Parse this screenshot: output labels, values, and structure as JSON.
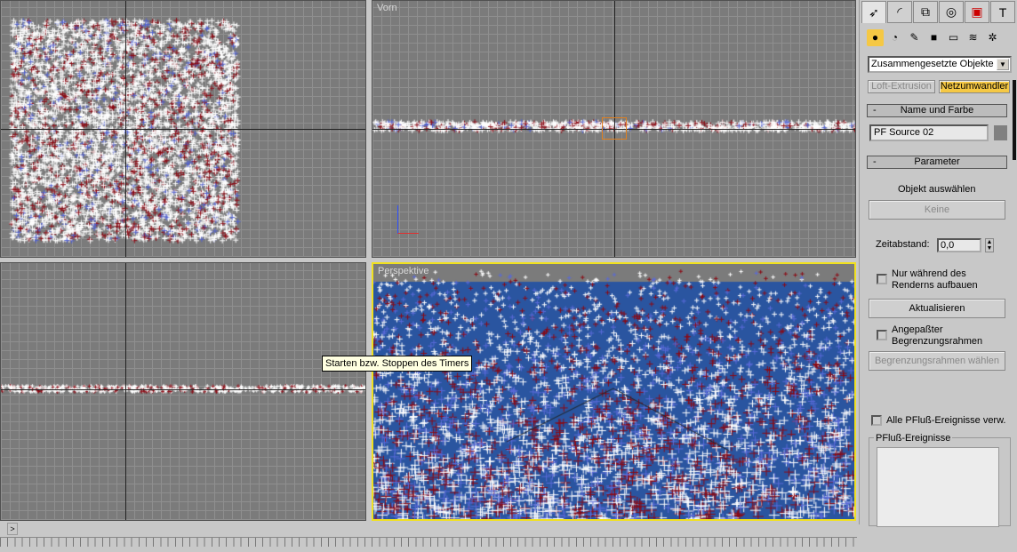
{
  "viewports": {
    "top_left": {
      "label": ""
    },
    "top_right": {
      "label": "Vorn"
    },
    "bottom_left": {
      "label": ""
    },
    "perspective": {
      "label": "Perspektive",
      "active": true
    }
  },
  "tooltip": "Starten bzw. Stoppen des Timers",
  "colors": {
    "viewport_bg": "#7b7b7b",
    "active_border": "#f0e020",
    "particles_white": "#ffffff",
    "particles_red": "#8b0a14",
    "perspective_ground": "#2a55a0",
    "highlight": "#f5c844"
  },
  "command_panel": {
    "tabs": [
      "create-icon",
      "modify-icon",
      "hierarchy-icon",
      "motion-icon",
      "display-icon",
      "utilities-icon"
    ],
    "category_icons": [
      "geometry-icon",
      "shapes-icon",
      "lights-icon",
      "cameras-icon",
      "helpers-icon",
      "spacewarps-icon",
      "systems-icon"
    ],
    "category_select": "Zusammengesetzte Objekte",
    "buttons_top": [
      "Loft-Extrusion",
      "Netzumwandler"
    ],
    "name_rollout": {
      "title": "Name und Farbe",
      "minus": "-",
      "name_value": "PF Source 02",
      "color": "#808080"
    },
    "param_rollout": {
      "title": "Parameter",
      "minus": "-",
      "pick_label": "Objekt auswählen",
      "pick_button": "Keine",
      "time_offset_label": "Zeitabstand:",
      "time_offset_value": "0,0",
      "render_only_label1": "Nur während des",
      "render_only_label2": "Renderns aufbauen",
      "render_only_checked": false,
      "update_button": "Aktualisieren",
      "custom_bbox_label1": "Angepaßter",
      "custom_bbox_label2": "Begrenzungsrahmen",
      "custom_bbox_checked": false,
      "pick_bbox_button": "Begrenzungsrahmen wählen",
      "all_events_label": "Alle PFluß-Ereignisse verw.",
      "all_events_checked": false,
      "events_group": "PFluß-Ereignisse"
    }
  },
  "timeslider": {
    "next_label": ">"
  }
}
